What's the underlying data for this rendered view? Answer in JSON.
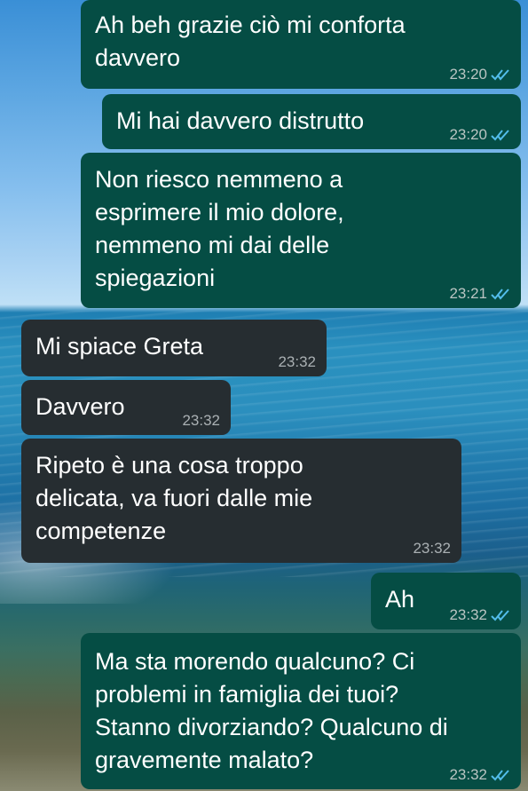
{
  "messages": [
    {
      "text": "Ah beh grazie ciò mi conforta\ndavvero",
      "time": "23:20",
      "ticks": "read"
    },
    {
      "text": "Mi hai davvero distrutto",
      "time": "23:20",
      "ticks": "read"
    },
    {
      "text": "Non riesco nemmeno a\nesprimere il mio dolore,\nnemmeno mi dai delle\nspiegazioni",
      "time": "23:21",
      "ticks": "read"
    },
    {
      "text": "Mi spiace Greta",
      "time": "23:32"
    },
    {
      "text": "Davvero",
      "time": "23:32"
    },
    {
      "text": "Ripeto è una cosa troppo\ndelicata, va fuori dalle mie\ncompetenze",
      "time": "23:32"
    },
    {
      "text": "Ah",
      "time": "23:32",
      "ticks": "read"
    },
    {
      "text": "Ma sta morendo qualcuno? Ci\nproblemi in famiglia dei tuoi?\nStanno divorziando? Qualcuno di\ngravemente malato?",
      "time": "23:32",
      "ticks": "read"
    }
  ],
  "colors": {
    "outgoing_bubble": "#054d44",
    "incoming_bubble": "#262d31",
    "read_ticks": "#53bdeb"
  }
}
